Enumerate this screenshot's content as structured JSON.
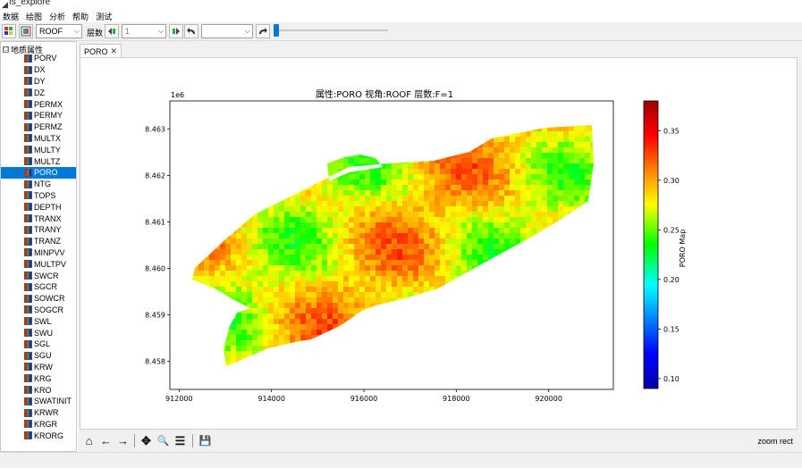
{
  "window": {
    "title": "fs_explore"
  },
  "menu": [
    "数据",
    "绘图",
    "分析",
    "帮助",
    "测试"
  ],
  "toolbar": {
    "view_value": "ROOF",
    "layer_label": "层数",
    "layer_value": "1",
    "blank_value": ""
  },
  "tree": {
    "root_label": "地质属性",
    "root_expander": "□",
    "selected": "PORO",
    "items": [
      "PORV",
      "DX",
      "DY",
      "DZ",
      "PERMX",
      "PERMY",
      "PERMZ",
      "MULTX",
      "MULTY",
      "MULTZ",
      "PORO",
      "NTG",
      "TOPS",
      "DEPTH",
      "TRANX",
      "TRANY",
      "TRANZ",
      "MINPVV",
      "MULTPV",
      "SWCR",
      "SGCR",
      "SOWCR",
      "SOGCR",
      "SWL",
      "SWU",
      "SGL",
      "SGU",
      "KRW",
      "KRG",
      "KRO",
      "SWATINIT",
      "KRWR",
      "KRGR",
      "KRORG"
    ]
  },
  "tabs": [
    {
      "label": "PORO",
      "close": "✕"
    }
  ],
  "status": {
    "mode": "zoom rect"
  },
  "nav": {
    "home": "⌂",
    "back": "←",
    "forward": "→",
    "pan": "✥",
    "zoom": "🔍",
    "config": "☰",
    "save": "💾"
  },
  "colors": {
    "accent": "#0078d7"
  },
  "chart_data": {
    "type": "heatmap",
    "title": "属性:PORO 视角:ROOF 层数:F=1",
    "offset_label": "1e6",
    "x_ticks": [
      "912000",
      "914000",
      "916000",
      "918000",
      "920000"
    ],
    "x_tick_values": [
      912000,
      914000,
      916000,
      918000,
      920000
    ],
    "y_ticks": [
      "8.463",
      "8.462",
      "8.461",
      "8.460",
      "8.459",
      "8.458"
    ],
    "y_tick_values": [
      8.463,
      8.462,
      8.461,
      8.46,
      8.459,
      8.458
    ],
    "xlim": [
      911800,
      921400
    ],
    "ylim": [
      8.4574,
      8.4636
    ],
    "colorbar": {
      "label": "PORO Map",
      "ticks": [
        "0.35",
        "0.30",
        "0.25",
        "0.20",
        "0.15",
        "0.10"
      ],
      "tick_values": [
        0.35,
        0.3,
        0.25,
        0.2,
        0.15,
        0.1
      ],
      "range": [
        0.09,
        0.38
      ]
    },
    "grid": false
  }
}
